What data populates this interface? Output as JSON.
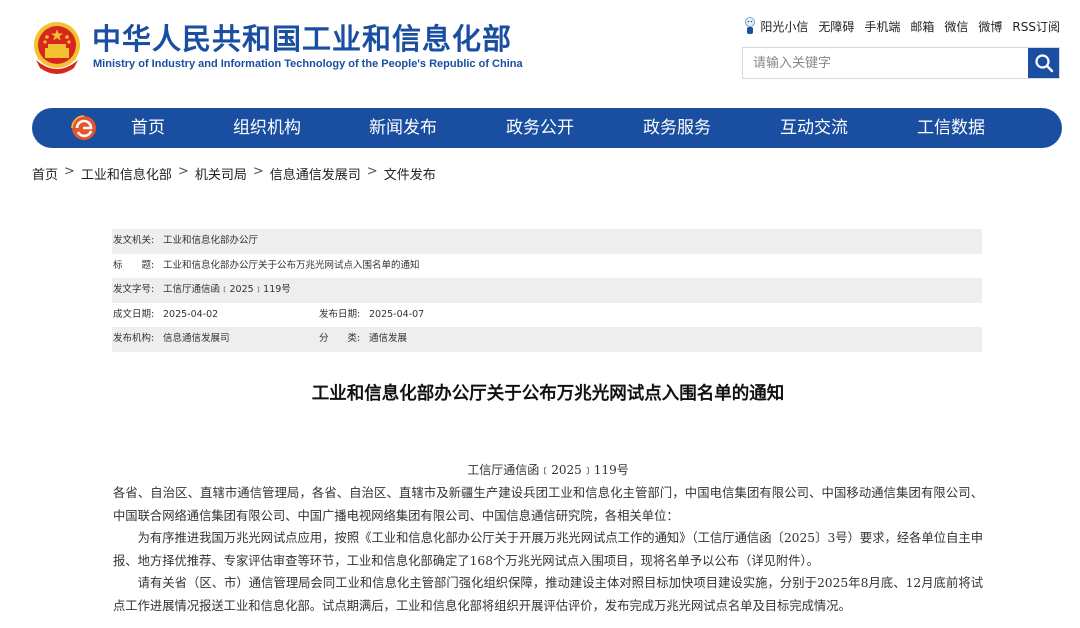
{
  "header": {
    "title": "中华人民共和国工业和信息化部",
    "subtitle": "Ministry of Industry and Information Technology of the People's Republic of China",
    "links": [
      "阳光小信",
      "无障碍",
      "手机端",
      "邮箱",
      "微信",
      "微博",
      "RSS订阅"
    ],
    "search_placeholder": "请输入关键字"
  },
  "nav": {
    "items": [
      "首页",
      "组织机构",
      "新闻发布",
      "政务公开",
      "政务服务",
      "互动交流",
      "工信数据"
    ]
  },
  "breadcrumb": [
    "首页",
    "工业和信息化部",
    "机关司局",
    "信息通信发展司",
    "文件发布"
  ],
  "meta": {
    "issuer_label": "发文机关:",
    "issuer": "工业和信息化部办公厅",
    "title_label": "标　　题:",
    "title": "工业和信息化部办公厅关于公布万兆光网试点入围名单的通知",
    "docno_label": "发文字号:",
    "docno": "工信厅通信函﹝2025﹞119号",
    "written_label": "成文日期:",
    "written": "2025-04-02",
    "published_label": "发布日期:",
    "published": "2025-04-07",
    "org_label": "发布机构:",
    "org": "信息通信发展司",
    "category_label": "分　　类:",
    "category": "通信发展"
  },
  "article": {
    "title": "工业和信息化部办公厅关于公布万兆光网试点入围名单的通知",
    "doc_number": "工信厅通信函﹝2025﹞119号",
    "paragraphs": [
      "各省、自治区、直辖市通信管理局，各省、自治区、直辖市及新疆生产建设兵团工业和信息化主管部门，中国电信集团有限公司、中国移动通信集团有限公司、中国联合网络通信集团有限公司、中国广播电视网络集团有限公司、中国信息通信研究院，各相关单位：",
      "为有序推进我国万兆光网试点应用，按照《工业和信息化部办公厅关于开展万兆光网试点工作的通知》（工信厅通信函〔2025〕3号）要求，经各单位自主申报、地方择优推荐、专家评估审查等环节，工业和信息化部确定了168个万兆光网试点入围项目，现将名单予以公布（详见附件）。",
      "请有关省（区、市）通信管理局会同工业和信息化主管部门强化组织保障，推动建设主体对照目标加快项目建设实施，分别于2025年8月底、12月底前将试点工作进展情况报送工业和信息化部。试点期满后，工业和信息化部将组织开展评估评价，发布完成万兆光网试点名单及目标完成情况。"
    ]
  },
  "colors": {
    "brand_blue": "#1a4ea1",
    "emblem_red": "#d7261e",
    "emblem_gold": "#f2c230"
  },
  "icons": [
    "national-emblem-icon",
    "sunshine-mascot-icon",
    "search-icon",
    "nav-logo-icon"
  ]
}
